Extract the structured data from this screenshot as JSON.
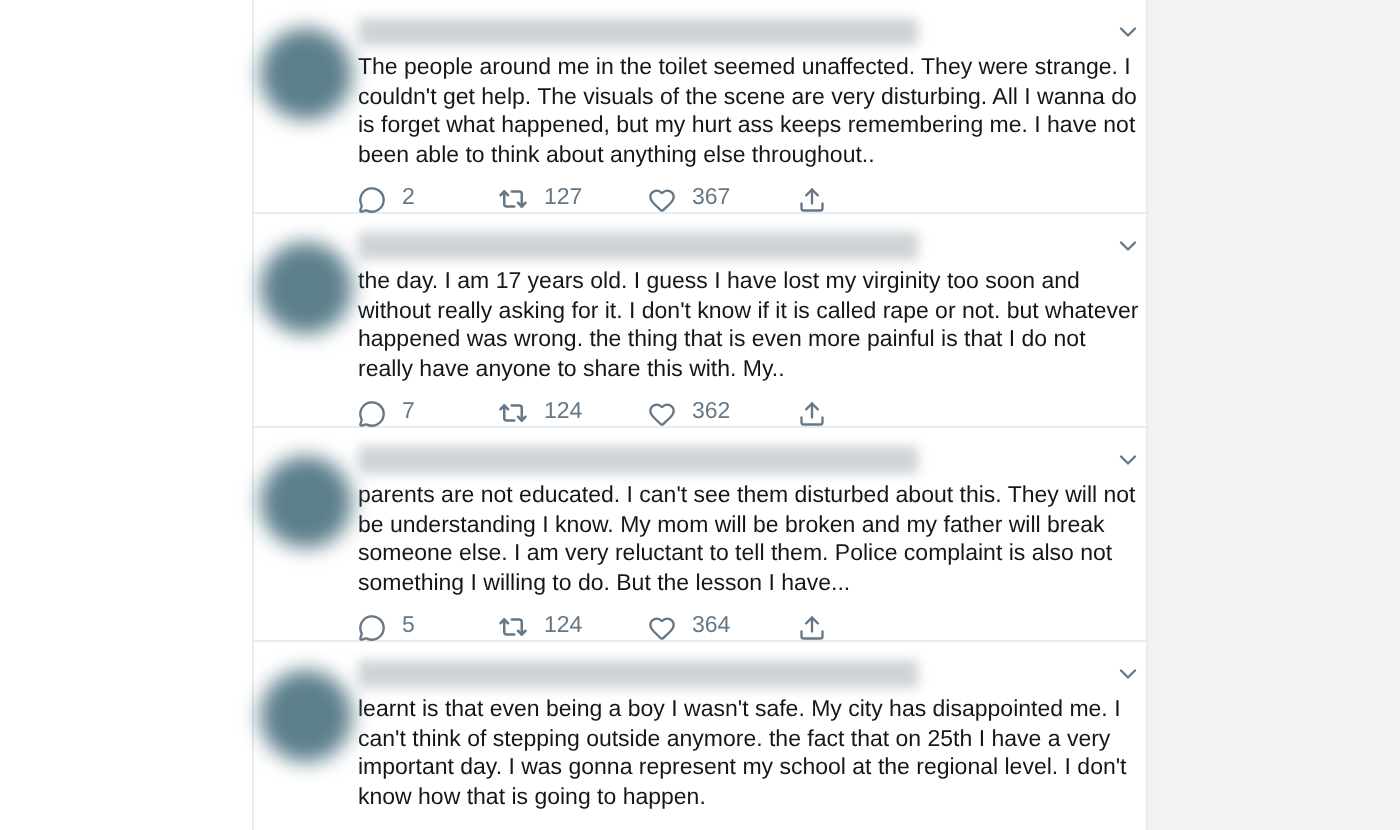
{
  "tweets": [
    {
      "text": "The people around me in the toilet seemed unaffected. They were strange. I couldn't get help. The visuals of the scene are very disturbing. All I wanna do is forget what happened, but my hurt ass keeps remembering me. I have not been able to think about anything else throughout..",
      "replies": "2",
      "retweets": "127",
      "likes": "367"
    },
    {
      "text": "the day. I am 17 years old. I guess I have lost my virginity too soon and without really asking for it. I don't know if it is called rape or not. but whatever happened was wrong. the thing that is even more painful is that I do not really have anyone to share this with. My..",
      "replies": "7",
      "retweets": "124",
      "likes": "362"
    },
    {
      "text": "parents are not educated. I can't see them disturbed about this. They will not be understanding I know. My mom will be broken and my father will break someone else. I am very reluctant to tell them. Police complaint is also not something I willing to do. But the lesson I have...",
      "replies": "5",
      "retweets": "124",
      "likes": "364"
    },
    {
      "text": "learnt is that even being a boy I wasn't safe. My city has disappointed me. I can't think of stepping outside anymore. the fact that on 25th I have a very important day. I was gonna represent my school at the regional level. I don't know how that is going to happen."
    }
  ]
}
